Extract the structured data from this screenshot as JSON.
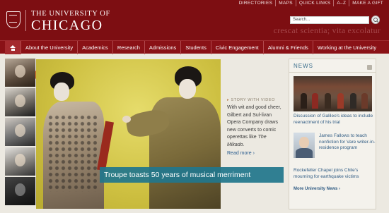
{
  "header": {
    "toplinks": [
      "DIRECTORIES",
      "MAPS",
      "QUICK LINKS",
      "A–Z",
      "MAKE A GIFT"
    ],
    "the": "THE UNIVERSITY OF",
    "name": "CHICAGO",
    "search_value": "Search...",
    "motto": "crescat scientia; vita excolatur"
  },
  "nav": {
    "items": [
      "About the University",
      "Academics",
      "Research",
      "Admissions",
      "Students",
      "Civic Engagement",
      "Alumni & Friends",
      "Working at the University"
    ]
  },
  "hero": {
    "caption": "Troupe toasts 50 years of musical merriment"
  },
  "story": {
    "label": "STORY WITH VIDEO",
    "body_pre": "With wit and good cheer, Gilbert and Sul-livan Opera Company draws new converts to comic operettas like ",
    "body_title": "The Mikado",
    "body_post": ".",
    "more": "Read more ›"
  },
  "news": {
    "title": "NEWS",
    "item1": "Discussion of Galileo's ideas to include reenactment of his trial",
    "item2": "James Fallows to teach nonfiction for Vare writer-in-residence program",
    "item3": "Rockefeller Chapel joins Chile's mourning for earthquake victims",
    "more": "More University News"
  },
  "colors": {
    "maroon": "#7d0e12",
    "caption_teal": "#21768c",
    "link_blue": "#2f5b83"
  }
}
